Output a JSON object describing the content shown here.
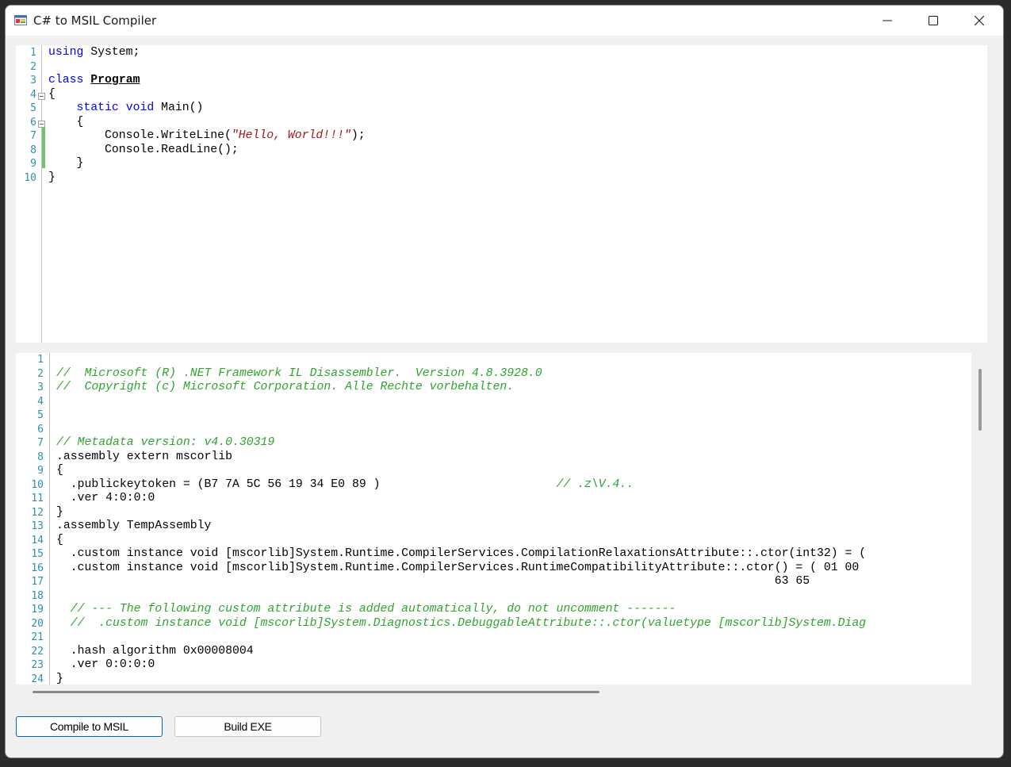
{
  "window": {
    "title": "C# to MSIL Compiler",
    "icon": "app-window-icon"
  },
  "title_controls": {
    "minimize": "minimize-icon",
    "maximize": "maximize-icon",
    "close": "close-icon"
  },
  "source_editor": {
    "line_numbers": [
      "1",
      "2",
      "3",
      "4",
      "5",
      "6",
      "7",
      "8",
      "9",
      "10"
    ],
    "lines": [
      [
        {
          "t": "using",
          "c": "kw"
        },
        {
          "t": " System;",
          "c": ""
        }
      ],
      [],
      [
        {
          "t": "class",
          "c": "kw"
        },
        {
          "t": " ",
          "c": ""
        },
        {
          "t": "Program",
          "c": "cls"
        }
      ],
      [
        {
          "t": "{",
          "c": ""
        }
      ],
      [
        {
          "t": "    ",
          "c": ""
        },
        {
          "t": "static",
          "c": "kw"
        },
        {
          "t": " ",
          "c": ""
        },
        {
          "t": "void",
          "c": "kw"
        },
        {
          "t": " Main()",
          "c": ""
        }
      ],
      [
        {
          "t": "    {",
          "c": ""
        }
      ],
      [
        {
          "t": "        Console.WriteLine(",
          "c": ""
        },
        {
          "t": "\"Hello, World!!!\"",
          "c": "str"
        },
        {
          "t": ");",
          "c": ""
        }
      ],
      [
        {
          "t": "        Console.ReadLine();",
          "c": ""
        }
      ],
      [
        {
          "t": "    }",
          "c": ""
        }
      ],
      [
        {
          "t": "}",
          "c": ""
        }
      ]
    ]
  },
  "msil_output": {
    "line_numbers": [
      "1",
      "2",
      "3",
      "4",
      "5",
      "6",
      "7",
      "8",
      "9",
      "10",
      "11",
      "12",
      "13",
      "14",
      "15",
      "16",
      "17",
      "18",
      "19",
      "20",
      "21",
      "22",
      "23",
      "24"
    ],
    "lines": [
      [],
      [
        {
          "t": "//  Microsoft (R) .NET Framework IL Disassembler.  Version 4.8.3928.0",
          "c": "cmt"
        }
      ],
      [
        {
          "t": "//  Copyright (c) Microsoft Corporation. Alle Rechte vorbehalten.",
          "c": "cmt"
        }
      ],
      [],
      [],
      [],
      [
        {
          "t": "// Metadata version: v4.0.30319",
          "c": "cmt"
        }
      ],
      [
        {
          "t": ".assembly extern mscorlib",
          "c": ""
        }
      ],
      [
        {
          "t": "{",
          "c": ""
        }
      ],
      [
        {
          "t": "  .publickeytoken = (B7 7A 5C 56 19 34 E0 89 )                         ",
          "c": ""
        },
        {
          "t": "// .z\\V.4..",
          "c": "cmt"
        }
      ],
      [
        {
          "t": "  .ver 4:0:0:0",
          "c": ""
        }
      ],
      [
        {
          "t": "}",
          "c": ""
        }
      ],
      [
        {
          "t": ".assembly TempAssembly",
          "c": ""
        }
      ],
      [
        {
          "t": "{",
          "c": ""
        }
      ],
      [
        {
          "t": "  .custom instance void [mscorlib]System.Runtime.CompilerServices.CompilationRelaxationsAttribute::.ctor(int32) = (",
          "c": ""
        }
      ],
      [
        {
          "t": "  .custom instance void [mscorlib]System.Runtime.CompilerServices.RuntimeCompatibilityAttribute::.ctor() = ( 01 00",
          "c": ""
        }
      ],
      [
        {
          "t": "                                                                                                      63 65",
          "c": ""
        }
      ],
      [],
      [
        {
          "t": "  // --- The following custom attribute is added automatically, do not uncomment -------",
          "c": "cmt"
        }
      ],
      [
        {
          "t": "  //  .custom instance void [mscorlib]System.Diagnostics.DebuggableAttribute::.ctor(valuetype [mscorlib]System.Diag",
          "c": "cmt"
        }
      ],
      [],
      [
        {
          "t": "  .hash algorithm 0x00008004",
          "c": ""
        }
      ],
      [
        {
          "t": "  .ver 0:0:0:0",
          "c": ""
        }
      ],
      [
        {
          "t": "}",
          "c": ""
        }
      ]
    ]
  },
  "buttons": {
    "compile": "Compile to MSIL",
    "build": "Build EXE"
  }
}
